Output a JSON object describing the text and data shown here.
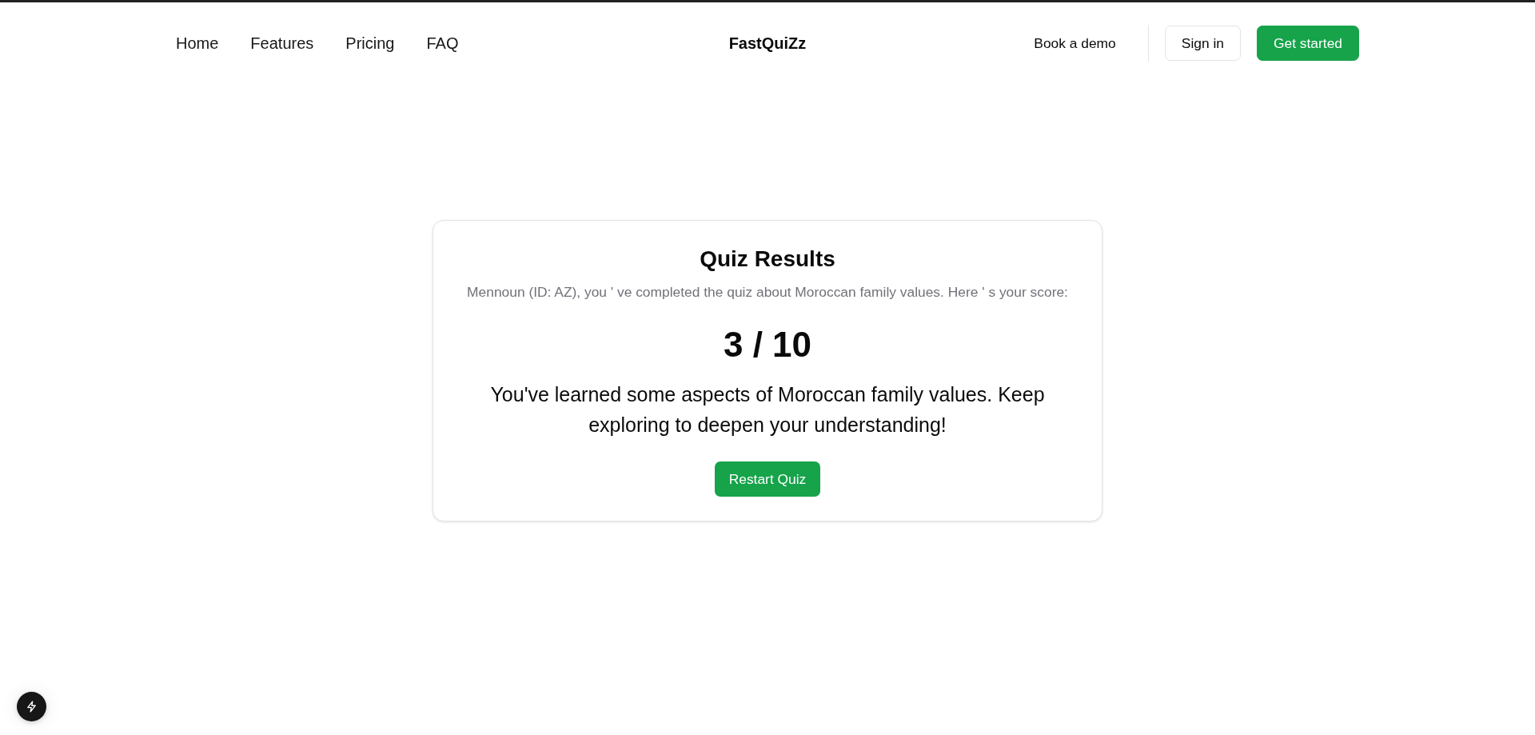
{
  "nav": {
    "links": [
      {
        "label": "Home"
      },
      {
        "label": "Features"
      },
      {
        "label": "Pricing"
      },
      {
        "label": "FAQ"
      }
    ],
    "logo": "FastQuiZz",
    "actions": [
      {
        "label": "Book a demo",
        "kind": "ghost"
      },
      {
        "label": "Sign in",
        "kind": "outline"
      },
      {
        "label": "Get started",
        "kind": "primary"
      }
    ]
  },
  "results": {
    "title": "Quiz Results",
    "subtitle": "Mennoun (ID: AZ), you ' ve completed the quiz about Moroccan family values. Here ' s your score:",
    "score": "3 / 10",
    "message": "You've learned some aspects of Moroccan family values. Keep exploring to deepen your understanding!",
    "button": "Restart Quiz"
  }
}
